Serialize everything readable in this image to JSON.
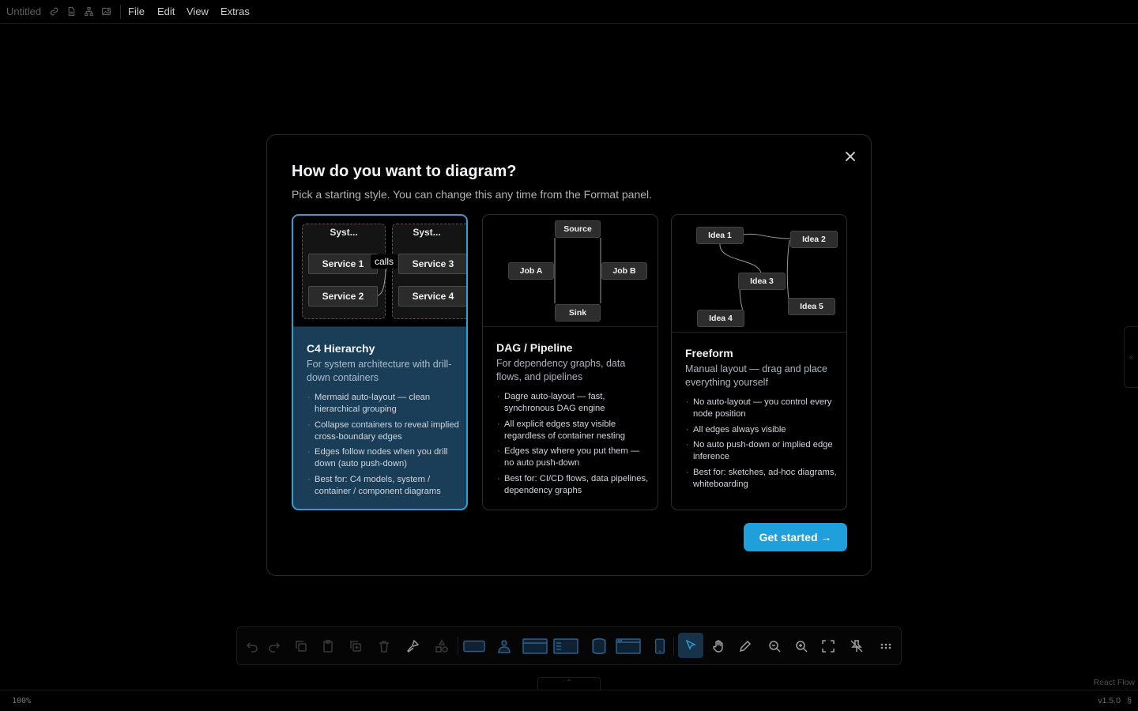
{
  "topbar": {
    "doc_title": "Untitled",
    "icons": [
      "link-icon",
      "file-icon",
      "tree-icon",
      "image-icon"
    ],
    "menu": [
      "File",
      "Edit",
      "View",
      "Extras"
    ]
  },
  "modal": {
    "title": "How do you want to diagram?",
    "subtitle": "Pick a starting style. You can change this any time from the Format panel.",
    "close_icon": "close-icon",
    "cta": "Get started →",
    "cards": [
      {
        "title": "C4 Hierarchy",
        "description": "For system architecture with drill-down containers",
        "selected": true,
        "bullets": [
          "Mermaid auto-layout — clean hierarchical grouping",
          "Collapse containers to reveal implied cross-boundary edges",
          "Edges follow nodes when you drill down (auto push-down)",
          "Best for: C4 models, system / container / component diagrams"
        ],
        "preview": {
          "containers": [
            "Syst...",
            "Syst..."
          ],
          "services": [
            "Service 1",
            "Service 2",
            "Service 3",
            "Service 4"
          ],
          "edge_label": "calls"
        }
      },
      {
        "title": "DAG / Pipeline",
        "description": "For dependency graphs, data flows, and pipelines",
        "selected": false,
        "bullets": [
          "Dagre auto-layout — fast, synchronous DAG engine",
          "All explicit edges stay visible regardless of container nesting",
          "Edges stay where you put them — no auto push-down",
          "Best for: CI/CD flows, data pipelines, dependency graphs"
        ],
        "preview": {
          "nodes": [
            "Source",
            "Job A",
            "Job B",
            "Sink"
          ]
        }
      },
      {
        "title": "Freeform",
        "description": "Manual layout — drag and place everything yourself",
        "selected": false,
        "bullets": [
          "No auto-layout — you control every node position",
          "All edges always visible",
          "No auto push-down or implied edge inference",
          "Best for: sketches, ad-hoc diagrams, whiteboarding"
        ],
        "preview": {
          "nodes": [
            "Idea 1",
            "Idea 2",
            "Idea 3",
            "Idea 4",
            "Idea 5"
          ]
        }
      }
    ]
  },
  "toolbar": {
    "tools": [
      "undo-icon",
      "redo-icon",
      "copy-icon",
      "paste-icon",
      "duplicate-icon",
      "delete-icon",
      "format-painter-icon",
      "shapes-icon",
      "rectangle-shape-icon",
      "person-shape-icon",
      "browser-shape-icon",
      "list-shape-icon",
      "database-shape-icon",
      "window-shape-icon",
      "mobile-shape-icon",
      "select-pointer-icon",
      "pan-hand-icon",
      "pencil-icon",
      "zoom-out-icon",
      "zoom-in-icon",
      "fit-view-icon",
      "unpin-icon",
      "more-icon"
    ],
    "active_tool": "select-pointer-icon"
  },
  "collapse_tab_icon": "⌃",
  "side_tab_icon": "«",
  "status": {
    "zoom": "100%",
    "version": "v1.5.0",
    "version_icon": "§",
    "attribution": "React Flow"
  },
  "colors": {
    "accent": "#1f9fdc",
    "selected_card_bg": "#1a3e58",
    "selected_card_border": "#2ea0d8"
  }
}
